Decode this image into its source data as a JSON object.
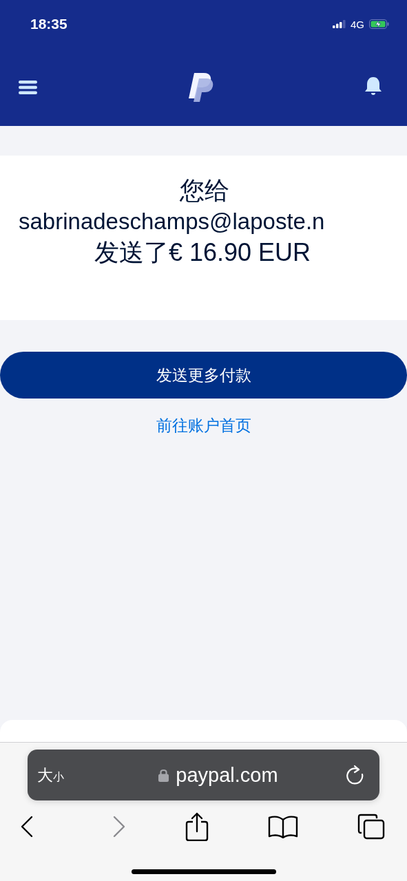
{
  "status_bar": {
    "time": "18:35",
    "network": "4G"
  },
  "confirmation": {
    "line_1": "您给",
    "recipient": "sabrinadeschamps@laposte.n",
    "line_3": "发送了€ 16.90 EUR"
  },
  "primary_button": "发送更多付款",
  "secondary_link": "前往账户首页",
  "browser": {
    "text_size_large": "大",
    "text_size_small": "小",
    "url": "paypal.com",
    "back_disabled": false,
    "forward_disabled": true
  }
}
